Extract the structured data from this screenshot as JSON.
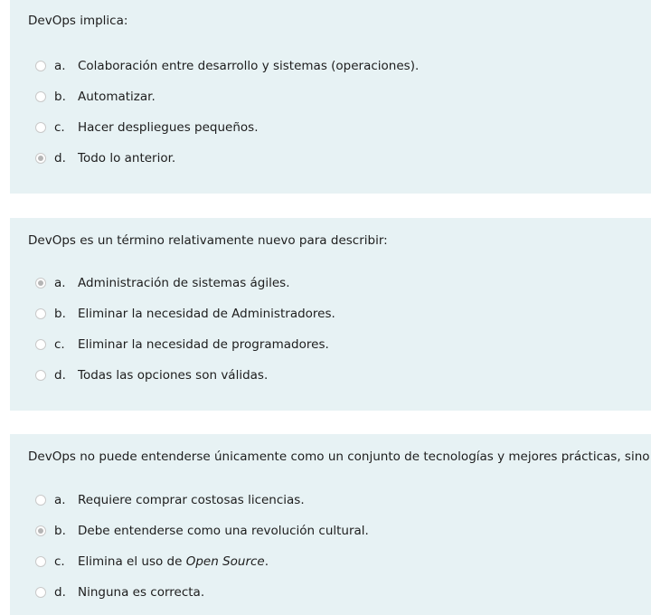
{
  "questions": [
    {
      "text": "DevOps implica:",
      "selected": "d",
      "options": [
        {
          "letter": "a.",
          "text": "Colaboración entre desarrollo y sistemas (operaciones)."
        },
        {
          "letter": "b.",
          "text": "Automatizar."
        },
        {
          "letter": "c.",
          "text": "Hacer despliegues pequeños."
        },
        {
          "letter": "d.",
          "text": "Todo lo anterior."
        }
      ]
    },
    {
      "text": "DevOps es un término relativamente nuevo para describir:",
      "selected": "a",
      "options": [
        {
          "letter": "a.",
          "text": "Administración de sistemas ágiles."
        },
        {
          "letter": "b.",
          "text": "Eliminar la necesidad de Administradores."
        },
        {
          "letter": "c.",
          "text": "Eliminar la necesidad de programadores."
        },
        {
          "letter": "d.",
          "text": "Todas las opciones son válidas."
        }
      ]
    },
    {
      "text": "DevOps no puede entenderse únicamente como un conjunto de tecnologías y mejores prácticas, sino que:",
      "selected": "b",
      "options": [
        {
          "letter": "a.",
          "text": "Requiere comprar costosas licencias."
        },
        {
          "letter": "b.",
          "text": "Debe entenderse como una revolución cultural."
        },
        {
          "letter": "c.",
          "text_prefix": "Elimina el uso de ",
          "text_italic": "Open Source",
          "text_suffix": "."
        },
        {
          "letter": "d.",
          "text": "Ninguna es correcta."
        }
      ]
    }
  ]
}
